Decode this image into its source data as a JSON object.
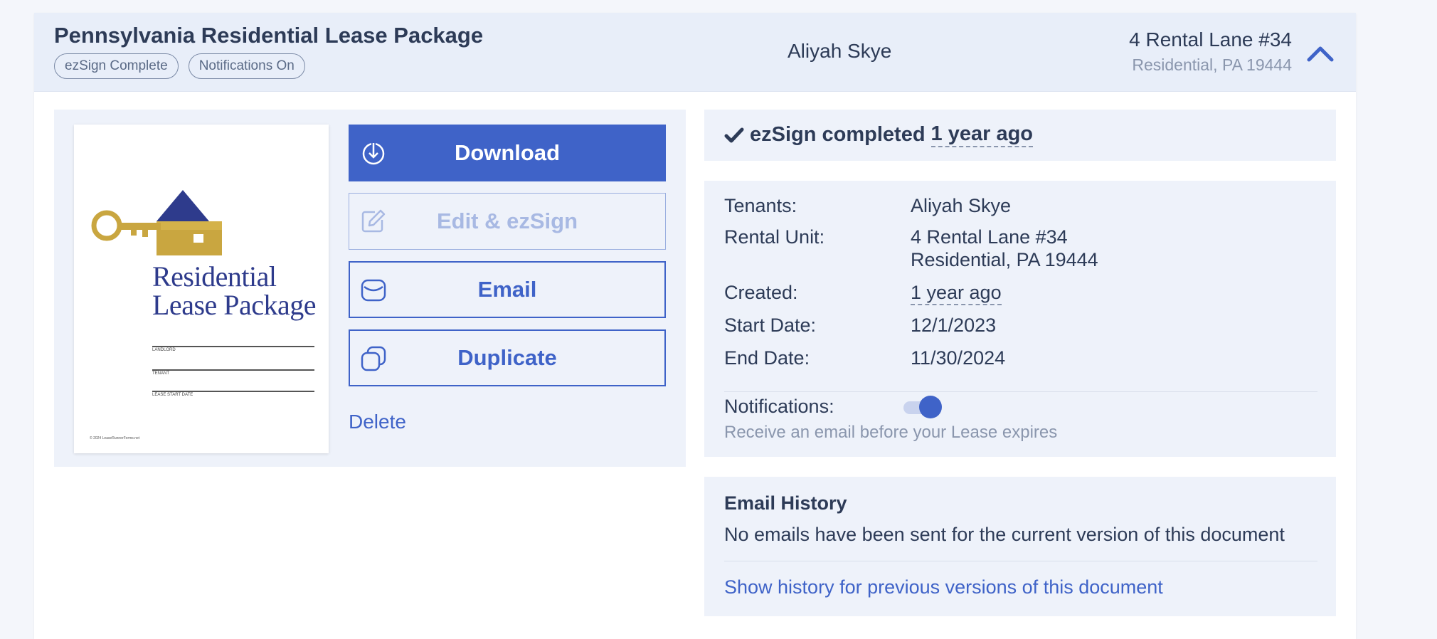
{
  "header": {
    "title": "Pennsylvania Residential Lease Package",
    "badges": [
      "ezSign Complete",
      "Notifications On"
    ],
    "tenant": "Aliyah Skye",
    "address_line1": "4 Rental Lane #34",
    "address_line2": "Residential, PA 19444"
  },
  "thumbnail": {
    "title_line1": "Residential",
    "title_line2": "Lease Package",
    "caption_landlord": "LANDLORD",
    "caption_tenant": "TENANT",
    "caption_start": "LEASE START DATE",
    "footer": "© 2024 LeaseRunnerForms.net"
  },
  "actions": {
    "download": "Download",
    "edit": "Edit & ezSign",
    "email": "Email",
    "duplicate": "Duplicate",
    "delete": "Delete"
  },
  "status": {
    "prefix": "ezSign completed",
    "when": "1 year ago"
  },
  "details": {
    "tenants_label": "Tenants:",
    "tenants_value": "Aliyah Skye",
    "unit_label": "Rental Unit:",
    "unit_line1": "4 Rental Lane #34",
    "unit_line2": "Residential, PA 19444",
    "created_label": "Created:",
    "created_value": "1 year ago",
    "start_label": "Start Date:",
    "start_value": "12/1/2023",
    "end_label": "End Date:",
    "end_value": "11/30/2024",
    "notifications_label": "Notifications:",
    "notifications_on": true,
    "notifications_help": "Receive an email before your Lease expires"
  },
  "email_history": {
    "title": "Email History",
    "message": "No emails have been sent for the current version of this document",
    "link": "Show history for previous versions of this document"
  },
  "colors": {
    "accent": "#3f63c8",
    "header_bg": "#e8eef9",
    "panel_bg": "#eef2fa",
    "text": "#2d3b57",
    "muted": "#8a96ad"
  }
}
